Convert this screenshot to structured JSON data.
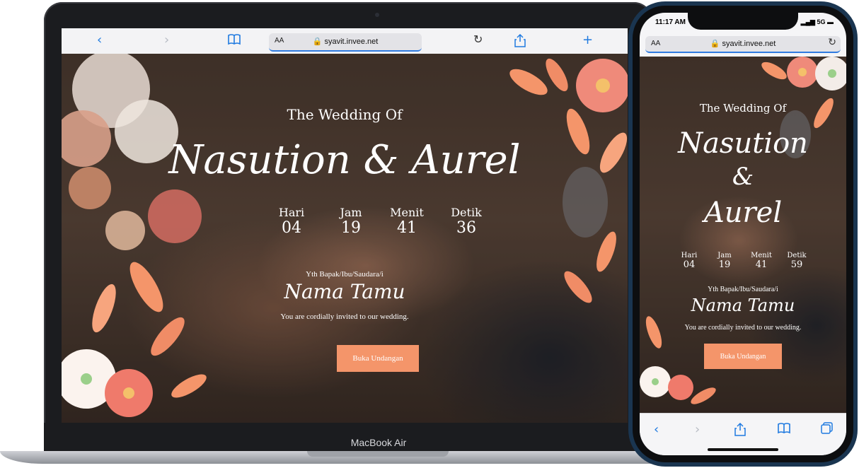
{
  "laptop": {
    "brand": "MacBook Air",
    "browser": {
      "back_icon": "chevron-left-icon",
      "forward_icon": "chevron-right-icon",
      "bookmarks_icon": "book-icon",
      "reader_label": "AA",
      "url": "syavit.invee.net",
      "reload_icon": "reload-icon",
      "share_icon": "share-icon",
      "new_tab_icon": "plus-icon"
    }
  },
  "phone": {
    "status": {
      "time": "11:17 AM",
      "network": "5G"
    },
    "browser": {
      "reader_label": "AA",
      "url": "syavit.invee.net"
    },
    "countdown": [
      {
        "label": "Hari",
        "value": "04"
      },
      {
        "label": "Jam",
        "value": "19"
      },
      {
        "label": "Menit",
        "value": "41"
      },
      {
        "label": "Detik",
        "value": "59"
      }
    ],
    "couple_line1": "Nasution",
    "couple_line2": "&",
    "couple_line3": "Aurel"
  },
  "site": {
    "subtitle": "The Wedding Of",
    "couple": "Nasution & Aurel",
    "countdown": [
      {
        "label": "Hari",
        "value": "04"
      },
      {
        "label": "Jam",
        "value": "19"
      },
      {
        "label": "Menit",
        "value": "41"
      },
      {
        "label": "Detik",
        "value": "36"
      }
    ],
    "greeting": "Yth Bapak/Ibu/Saudara/i",
    "guest_name": "Nama Tamu",
    "invite_text": "You are cordially invited to our wedding.",
    "button_label": "Buka Undangan"
  },
  "colors": {
    "accent": "#f4956a",
    "browser_blue": "#1f7ae0",
    "phone_frame": "#1a3550"
  }
}
